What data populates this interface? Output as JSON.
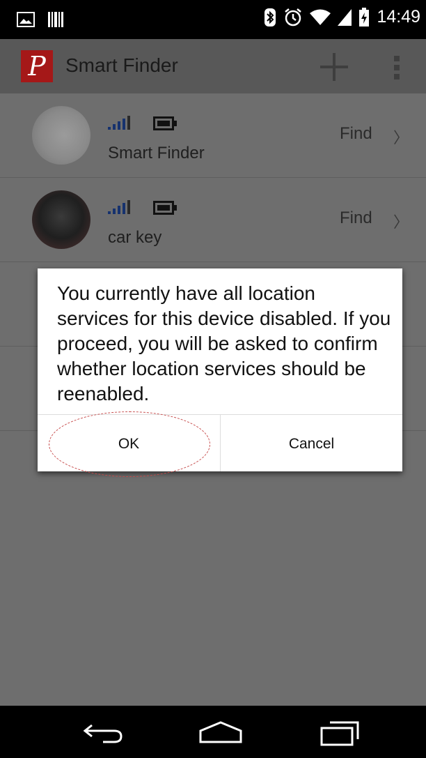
{
  "status_bar": {
    "time": "14:49",
    "icons": [
      "image-icon",
      "barcode-icon",
      "bluetooth-icon",
      "alarm-icon",
      "wifi-icon",
      "signal-icon",
      "battery-charging-icon"
    ]
  },
  "app_bar": {
    "logo_letter": "P",
    "title": "Smart Finder",
    "actions": [
      "plus-icon",
      "overflow-menu-icon"
    ]
  },
  "devices": [
    {
      "name": "Smart Finder",
      "action": "Find",
      "chevron": "〉"
    },
    {
      "name": "car key",
      "action": "Find",
      "chevron": "〉"
    }
  ],
  "dialog": {
    "message": "You currently have all location services for this device disabled. If you proceed, you will be asked to confirm whether location services should be reenabled.",
    "ok_label": "OK",
    "cancel_label": "Cancel"
  },
  "colors": {
    "app_logo": "#a51818",
    "highlight": "#c64a4a",
    "signal": "#16326e"
  }
}
